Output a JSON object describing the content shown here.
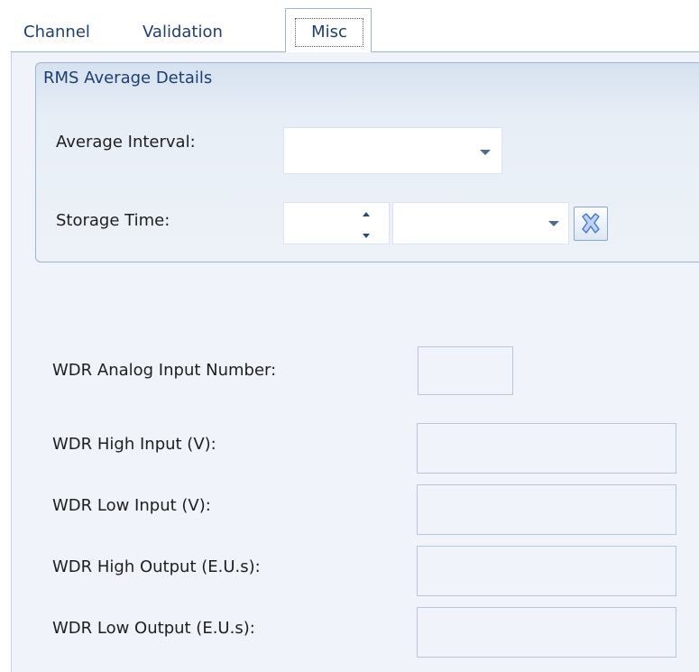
{
  "tabs": [
    {
      "label": "Channel"
    },
    {
      "label": "Validation"
    },
    {
      "label": "Misc"
    }
  ],
  "active_tab": "Misc",
  "rms_group": {
    "title": "RMS Average Details",
    "average_interval_label": "Average Interval:",
    "average_interval_value": "",
    "storage_time_label": "Storage Time:",
    "storage_time_value": "",
    "storage_time_unit": ""
  },
  "wdr": {
    "analog_input_number_label": "WDR Analog Input Number:",
    "high_input_label": "WDR High Input (V):",
    "low_input_label": "WDR Low Input (V):",
    "high_output_label": "WDR High Output (E.U.s):",
    "low_output_label": "WDR Low Output (E.U.s):"
  },
  "icons": {
    "clear": "clear-x-icon",
    "dropdown": "chevron-down-icon",
    "spin_up": "arrow-up-icon",
    "spin_down": "arrow-down-icon"
  },
  "colors": {
    "tab_text": "#1e3f6e",
    "panel_background": "#f0f4fa",
    "group_border": "#9fb4d2",
    "field_border": "#b7c6db"
  }
}
